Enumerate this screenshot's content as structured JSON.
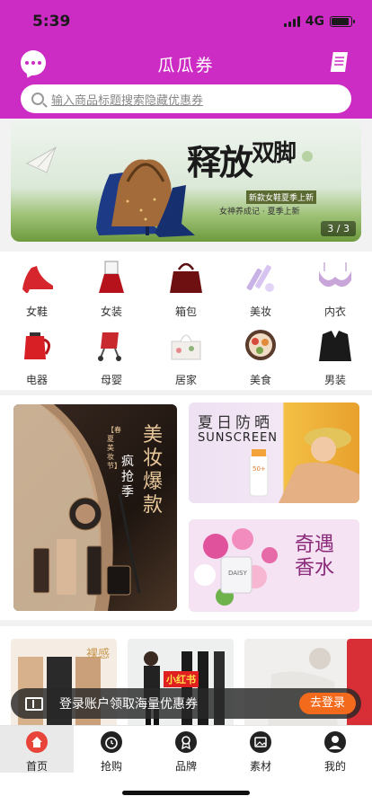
{
  "status": {
    "time": "5:39",
    "network": "4G",
    "battery_level": 0.9
  },
  "header": {
    "title": "瓜瓜券"
  },
  "search": {
    "placeholder": "输入商品标题搜索隐藏优惠券"
  },
  "banner": {
    "title_a": "释放",
    "title_b": "双脚",
    "subtitle": "新款女鞋夏季上新",
    "tagline": "女神养成记 · 夏季上新",
    "pager": "3 / 3"
  },
  "categories": [
    {
      "label": "女鞋",
      "icon": "high-heel-icon"
    },
    {
      "label": "女装",
      "icon": "dress-icon"
    },
    {
      "label": "箱包",
      "icon": "handbag-icon"
    },
    {
      "label": "美妆",
      "icon": "cosmetics-icon"
    },
    {
      "label": "内衣",
      "icon": "bra-icon"
    },
    {
      "label": "电器",
      "icon": "kettle-icon"
    },
    {
      "label": "母婴",
      "icon": "stroller-icon"
    },
    {
      "label": "居家",
      "icon": "tissue-box-icon"
    },
    {
      "label": "美食",
      "icon": "food-plate-icon"
    },
    {
      "label": "男装",
      "icon": "suit-icon"
    }
  ],
  "promos": {
    "left": {
      "title": "美妆爆款",
      "sub": "疯抢季",
      "tag": "【春夏美妆节】"
    },
    "right_top": {
      "title": "夏日防晒",
      "sub": "SUNSCREEN",
      "badge": "50+"
    },
    "right_bottom": {
      "title": "奇遇香水",
      "sub": "DAISY"
    }
  },
  "feed": {
    "card2_badge": "小红书",
    "card1_text": "裸感"
  },
  "login_bar": {
    "text": "登录账户领取海量优惠券",
    "button": "去登录"
  },
  "tabs": [
    {
      "label": "首页",
      "icon": "home-icon",
      "active": true
    },
    {
      "label": "抢购",
      "icon": "alarm-clock-icon",
      "active": false
    },
    {
      "label": "品牌",
      "icon": "brand-badge-icon",
      "active": false
    },
    {
      "label": "素材",
      "icon": "image-add-icon",
      "active": false
    },
    {
      "label": "我的",
      "icon": "user-icon",
      "active": false
    }
  ],
  "colors": {
    "brand": "#cc2bc4",
    "accent": "#f36a1d",
    "home_tab": "#e8443a"
  }
}
